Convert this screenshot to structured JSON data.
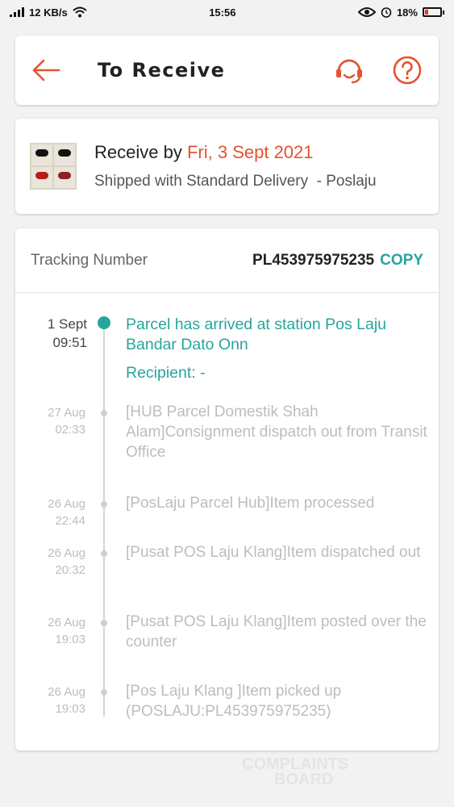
{
  "status_bar": {
    "net_speed": "12 KB/s",
    "time": "15:56",
    "battery": "18%"
  },
  "header": {
    "title": "To Receive",
    "accent_color": "#e4532f"
  },
  "delivery": {
    "receive_prefix": "Receive by",
    "receive_date": "Fri, 3 Sept 2021",
    "shipping": "Shipped with Standard Delivery  - Poslaju"
  },
  "tracking": {
    "label": "Tracking Number",
    "number": "PL453975975235",
    "copy_label": "COPY",
    "accent_color": "#26a69a",
    "events": [
      {
        "date": "1 Sept",
        "time": "09:51",
        "desc": "Parcel has arrived at station Pos Laju Bandar Dato Onn",
        "recipient": "Recipient: -"
      },
      {
        "date": "27 Aug",
        "time": "02:33",
        "desc": "[HUB Parcel Domestik Shah Alam]Consignment dispatch out from Transit Office"
      },
      {
        "date": "26 Aug",
        "time": "22:44",
        "desc": "[PosLaju Parcel Hub]Item processed"
      },
      {
        "date": "26 Aug",
        "time": "20:32",
        "desc": "[Pusat POS Laju Klang]Item dispatched out"
      },
      {
        "date": "26 Aug",
        "time": "19:03",
        "desc": "[Pusat POS Laju Klang]Item posted over the counter"
      },
      {
        "date": "26 Aug",
        "time": "19:03",
        "desc": "[Pos Laju Klang ]Item picked up (POSLAJU:PL453975975235)"
      }
    ]
  },
  "watermark": {
    "line1": "COMPLAINTS",
    "line2": "BOARD"
  }
}
